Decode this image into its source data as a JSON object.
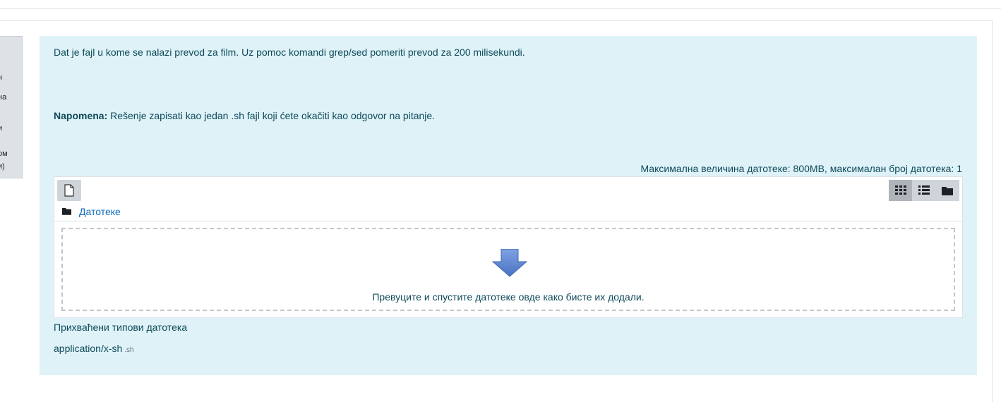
{
  "sidebar_info": {
    "fragments": [
      "н",
      "на",
      "и",
      "ом",
      "и)"
    ]
  },
  "question": {
    "text": "Dat je fajl u kome se nalazi prevod za film. Uz pomoc komandi grep/sed pomeriti prevod za 200 milisekundi.",
    "note_label": "Napomena:",
    "note_text": " Rešenje zapisati kao jedan .sh fajl koji ćete okačiti kao odgovor na pitanje."
  },
  "filepicker": {
    "max_size_text": "Максимална величина датотеке: 800MB, максималан број датотека: 1",
    "add_file_icon": "file-icon",
    "view_icons": [
      "grid-icon",
      "list-icon",
      "folder-icon"
    ],
    "path_icon": "folder-icon",
    "path_label": "Датотеке",
    "drop_icon": "down-arrow-icon",
    "drop_message": "Превуците и спустите датотеке овде како бисте их додали."
  },
  "accepted": {
    "title": "Прихваћени типови датотека",
    "type": "application/x-sh",
    "ext": ".sh"
  },
  "colors": {
    "panel_bg": "#def2f8",
    "text": "#0f4a5a",
    "link": "#0f6cbf",
    "button_bg": "#ced4da",
    "arrow": "#5b84cf"
  }
}
